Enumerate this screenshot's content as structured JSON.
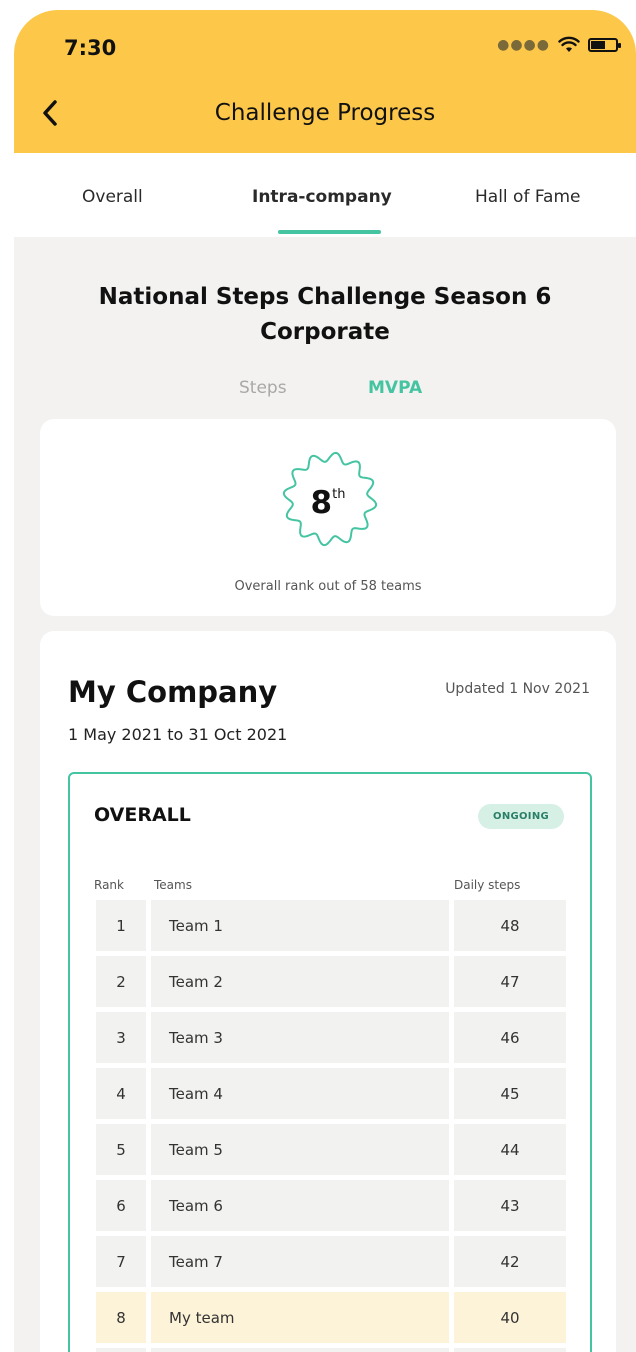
{
  "status_bar": {
    "time": "7:30"
  },
  "header": {
    "title": "Challenge Progress"
  },
  "tabs": [
    {
      "label": "Overall",
      "active": false
    },
    {
      "label": "Intra-company",
      "active": true
    },
    {
      "label": "Hall of Fame",
      "active": false
    }
  ],
  "challenge": {
    "title_line1": "National Steps Challenge Season 6",
    "title_line2": "Corporate",
    "metrics": [
      {
        "label": "Steps",
        "active": false
      },
      {
        "label": "MVPA",
        "active": true
      }
    ]
  },
  "rank_card": {
    "rank": "8",
    "suffix": "th",
    "caption": "Overall rank out of 58 teams"
  },
  "company": {
    "name": "My Company",
    "updated": "Updated 1 Nov 2021",
    "period": "1 May 2021 to 31 Oct 2021"
  },
  "leaderboard": {
    "title": "OVERALL",
    "status": "ONGOING",
    "columns": {
      "rank": "Rank",
      "teams": "Teams",
      "steps": "Daily steps"
    },
    "rows": [
      {
        "rank": "1",
        "team": "Team 1",
        "steps": "48"
      },
      {
        "rank": "2",
        "team": "Team 2",
        "steps": "47"
      },
      {
        "rank": "3",
        "team": "Team 3",
        "steps": "46"
      },
      {
        "rank": "4",
        "team": "Team 4",
        "steps": "45"
      },
      {
        "rank": "5",
        "team": "Team 5",
        "steps": "44"
      },
      {
        "rank": "6",
        "team": "Team 6",
        "steps": "43"
      },
      {
        "rank": "7",
        "team": "Team 7",
        "steps": "42"
      },
      {
        "rank": "8",
        "team": "My team",
        "steps": "40",
        "highlight": true
      }
    ]
  },
  "colors": {
    "header_bg": "#fdc84a",
    "accent": "#45c4a2",
    "highlight_row": "#fdf3d9",
    "page_bg": "#f3f2f0"
  }
}
